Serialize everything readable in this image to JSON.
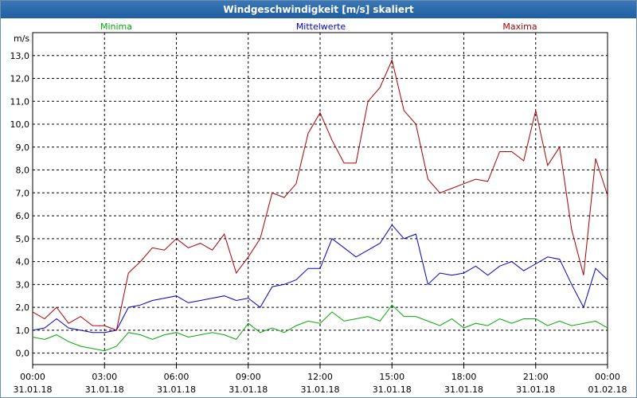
{
  "window": {
    "title": "Windgeschwindigkeit [m/s] skaliert"
  },
  "chart_data": {
    "type": "line",
    "title": "Windgeschwindigkeit [m/s] skaliert",
    "ylabel": "m/s",
    "xlabel": "",
    "ylim": [
      -0.5,
      14.0
    ],
    "xlim": [
      0,
      24
    ],
    "grid": true,
    "legend_placement": "top",
    "y_ticks": [
      "0,0",
      "1,0",
      "2,0",
      "3,0",
      "4,0",
      "5,0",
      "6,0",
      "7,0",
      "8,0",
      "9,0",
      "10,0",
      "11,0",
      "12,0",
      "13,0"
    ],
    "x_ticks": [
      {
        "time": "00:00",
        "date": "31.01.18"
      },
      {
        "time": "03:00",
        "date": "31.01.18"
      },
      {
        "time": "06:00",
        "date": "31.01.18"
      },
      {
        "time": "09:00",
        "date": "31.01.18"
      },
      {
        "time": "12:00",
        "date": "31.01.18"
      },
      {
        "time": "15:00",
        "date": "31.01.18"
      },
      {
        "time": "18:00",
        "date": "31.01.18"
      },
      {
        "time": "21:00",
        "date": "31.01.18"
      },
      {
        "time": "00:00",
        "date": "01.02.18"
      }
    ],
    "x_hours": [
      0,
      0.5,
      1,
      1.5,
      2,
      2.5,
      3,
      3.5,
      4,
      4.5,
      5,
      5.5,
      6,
      6.5,
      7,
      7.5,
      8,
      8.5,
      9,
      9.5,
      10,
      10.5,
      11,
      11.5,
      12,
      12.5,
      13,
      13.5,
      14,
      14.5,
      15,
      15.5,
      16,
      16.5,
      17,
      17.5,
      18,
      18.5,
      19,
      19.5,
      20,
      20.5,
      21,
      21.5,
      22,
      22.5,
      23,
      23.5,
      24
    ],
    "series": [
      {
        "name": "Minima",
        "color": "#00aa00",
        "values": [
          0.7,
          0.6,
          0.8,
          0.5,
          0.3,
          0.2,
          0.1,
          0.3,
          0.9,
          0.8,
          0.6,
          0.8,
          0.9,
          0.7,
          0.8,
          0.9,
          0.8,
          0.6,
          1.3,
          0.9,
          1.1,
          0.9,
          1.2,
          1.4,
          1.3,
          1.8,
          1.4,
          1.5,
          1.6,
          1.4,
          2.1,
          1.6,
          1.6,
          1.4,
          1.2,
          1.5,
          1.1,
          1.3,
          1.2,
          1.5,
          1.3,
          1.5,
          1.5,
          1.2,
          1.4,
          1.2,
          1.3,
          1.4,
          1.1
        ]
      },
      {
        "name": "Mittelwerte",
        "color": "#0000c8",
        "values": [
          1.0,
          1.1,
          1.5,
          1.1,
          1.0,
          0.9,
          0.9,
          1.0,
          2.0,
          2.1,
          2.3,
          2.4,
          2.5,
          2.2,
          2.3,
          2.4,
          2.5,
          2.3,
          2.4,
          2.0,
          2.9,
          3.0,
          3.2,
          3.7,
          3.7,
          5.0,
          4.6,
          4.2,
          4.5,
          4.8,
          5.6,
          5.0,
          5.2,
          3.0,
          3.5,
          3.4,
          3.5,
          3.8,
          3.4,
          3.8,
          4.0,
          3.6,
          3.9,
          4.2,
          4.1,
          3.0,
          2.0,
          3.7,
          3.2
        ]
      },
      {
        "name": "Maxima",
        "color": "#aa0000",
        "values": [
          1.8,
          1.5,
          2.0,
          1.3,
          1.6,
          1.2,
          1.2,
          1.0,
          3.5,
          4.0,
          4.6,
          4.5,
          5.0,
          4.6,
          4.8,
          4.5,
          5.2,
          3.5,
          4.2,
          5.0,
          7.0,
          6.8,
          7.4,
          9.6,
          10.5,
          9.3,
          8.3,
          8.3,
          11.0,
          11.6,
          12.8,
          10.6,
          10.0,
          7.6,
          7.0,
          7.2,
          7.4,
          7.6,
          7.5,
          8.8,
          8.8,
          8.4,
          10.6,
          8.2,
          9.0,
          5.4,
          3.4,
          8.5,
          6.9
        ]
      }
    ]
  }
}
